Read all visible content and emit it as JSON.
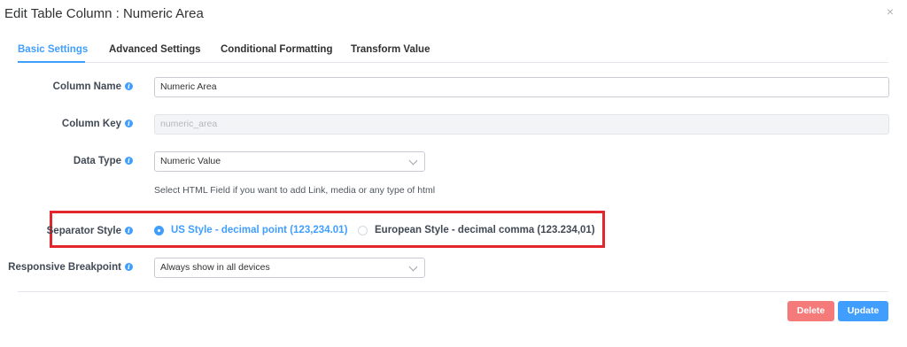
{
  "dialog": {
    "title": "Edit Table Column : Numeric Area",
    "close_icon": "×"
  },
  "tabs": [
    {
      "label": "Basic Settings",
      "active": true
    },
    {
      "label": "Advanced Settings",
      "active": false
    },
    {
      "label": "Conditional Formatting",
      "active": false
    },
    {
      "label": "Transform Value",
      "active": false
    }
  ],
  "form": {
    "column_name": {
      "label": "Column Name",
      "value": "Numeric Area"
    },
    "column_key": {
      "label": "Column Key",
      "value": "numeric_area"
    },
    "data_type": {
      "label": "Data Type",
      "selected": "Numeric Value",
      "help": "Select HTML Field if you want to add Link, media or any type of html"
    },
    "separator_style": {
      "label": "Separator Style",
      "options": [
        {
          "label": "US Style - decimal point (123,234.01)",
          "checked": true
        },
        {
          "label": "European Style - decimal comma (123.234,01)",
          "checked": false
        }
      ]
    },
    "responsive_breakpoint": {
      "label": "Responsive Breakpoint",
      "selected": "Always show in all devices"
    }
  },
  "footer": {
    "delete_label": "Delete",
    "update_label": "Update"
  },
  "colors": {
    "accent": "#409eff",
    "danger": "#f56c6c",
    "highlight": "#e3262b"
  }
}
